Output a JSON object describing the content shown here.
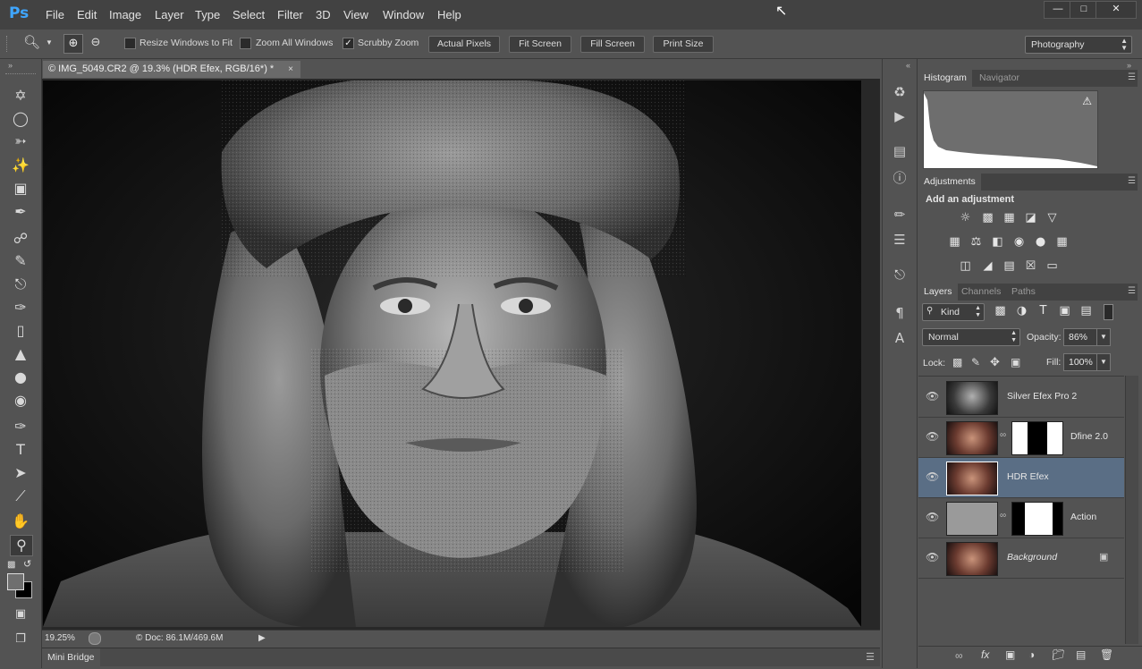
{
  "app": {
    "logo": "Ps"
  },
  "menu": [
    "File",
    "Edit",
    "Image",
    "Layer",
    "Type",
    "Select",
    "Filter",
    "3D",
    "View",
    "Window",
    "Help"
  ],
  "window_controls": {
    "minimize": "—",
    "maximize": "□",
    "close": "✕"
  },
  "options_bar": {
    "zoom_tool_icon": "magnifier-icon",
    "checkboxes": [
      {
        "label": "Resize Windows to Fit",
        "checked": false
      },
      {
        "label": "Zoom All Windows",
        "checked": false
      },
      {
        "label": "Scrubby Zoom",
        "checked": true
      }
    ],
    "buttons": [
      "Actual Pixels",
      "Fit Screen",
      "Fill Screen",
      "Print Size"
    ],
    "workspace": "Photography"
  },
  "document": {
    "tab_title": "© IMG_5049.CR2 @ 19.3% (HDR Efex, RGB/16*) *",
    "zoom": "19.25%",
    "doc_size": "© Doc: 86.1M/469.6M"
  },
  "mini_bridge": {
    "label": "Mini Bridge"
  },
  "panels": {
    "histogram": {
      "tabs": [
        "Histogram",
        "Navigator"
      ],
      "active": "Histogram"
    },
    "adjustments": {
      "tab": "Adjustments",
      "heading": "Add an adjustment"
    },
    "layers": {
      "tabs": [
        "Layers",
        "Channels",
        "Paths"
      ],
      "active": "Layers",
      "filter_kind": "Kind",
      "blend_mode": "Normal",
      "opacity_label": "Opacity:",
      "opacity": "86%",
      "lock_label": "Lock:",
      "fill_label": "Fill:",
      "fill": "100%",
      "items": [
        {
          "name": "Silver Efex Pro 2",
          "mask": false,
          "selected": false,
          "italic": false
        },
        {
          "name": "Dfine 2.0",
          "mask": true,
          "selected": false,
          "italic": false
        },
        {
          "name": "HDR Efex",
          "mask": false,
          "selected": true,
          "italic": false
        },
        {
          "name": "Action",
          "mask": true,
          "selected": false,
          "italic": false
        },
        {
          "name": "Background",
          "mask": false,
          "selected": false,
          "italic": true,
          "locked": true
        }
      ]
    }
  },
  "colors": {
    "menubar": "#424242",
    "workspace": "#535353",
    "accent_selected": "#5a6e85",
    "ps_blue": "#3fa6ff"
  }
}
